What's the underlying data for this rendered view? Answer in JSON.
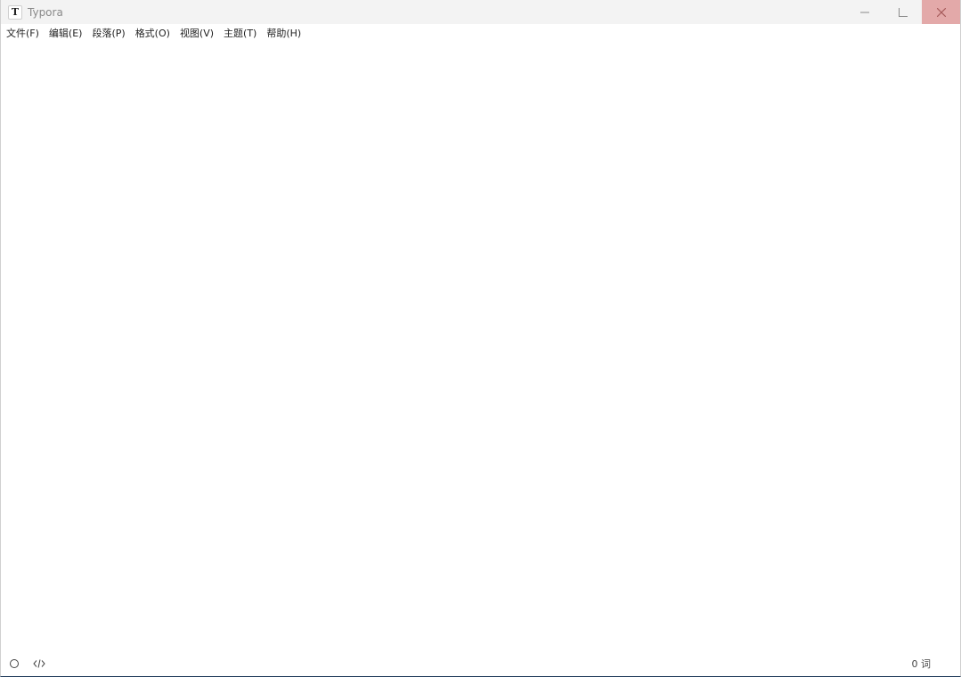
{
  "window": {
    "title": "Typora",
    "app_icon_letter": "T"
  },
  "menubar": {
    "items": [
      {
        "label": "文件(F)"
      },
      {
        "label": "编辑(E)"
      },
      {
        "label": "段落(P)"
      },
      {
        "label": "格式(O)"
      },
      {
        "label": "视图(V)"
      },
      {
        "label": "主题(T)"
      },
      {
        "label": "帮助(H)"
      }
    ]
  },
  "statusbar": {
    "word_count": "0 词",
    "left_icons": [
      "outline-circle-icon",
      "source-code-icon"
    ]
  },
  "colors": {
    "titlebar_bg": "#f3f3f3",
    "close_button_bg": "#e3a9a9"
  }
}
